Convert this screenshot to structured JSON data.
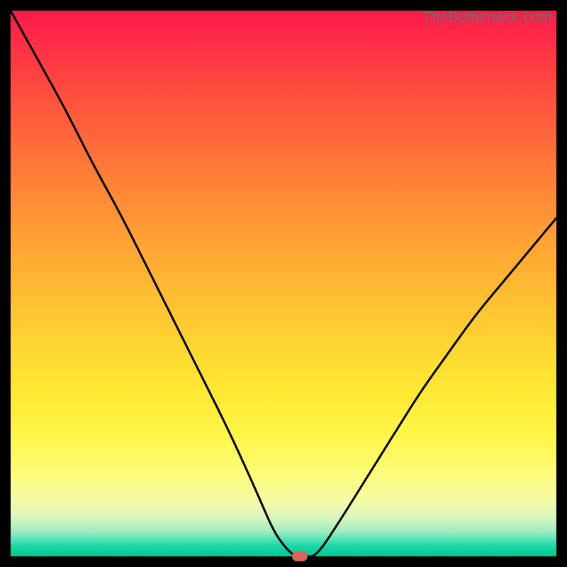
{
  "attribution": "TheBottleneck.com",
  "colors": {
    "curve": "#000000",
    "marker": "#d9645c",
    "frame": "#000000"
  },
  "chart_data": {
    "type": "line",
    "title": "",
    "xlabel": "",
    "ylabel": "",
    "xlim": [
      0,
      100
    ],
    "ylim": [
      0,
      100
    ],
    "grid": false,
    "legend": false,
    "background_gradient": {
      "top": "#ff1a4a",
      "middle": "#ffd732",
      "bottom": "#05c892",
      "note": "red→yellow→green vertical gradient; green (good) near y=0"
    },
    "series": [
      {
        "name": "bottleneck-curve",
        "x": [
          0,
          5,
          10,
          15,
          20,
          25,
          30,
          35,
          40,
          45,
          48,
          50,
          52,
          54,
          56,
          60,
          65,
          70,
          75,
          80,
          85,
          90,
          95,
          100
        ],
        "y": [
          100,
          91,
          82,
          72,
          63,
          53,
          43,
          33,
          23,
          12,
          5,
          2,
          0,
          0,
          0,
          6,
          14,
          22,
          30,
          37,
          44,
          50,
          56,
          62
        ],
        "stroke_width": 3
      }
    ],
    "marker": {
      "x": 53,
      "y": 0,
      "shape": "rounded-rect",
      "color": "#d9645c"
    },
    "notes": "values read off plot; x-axis and y-axis unlabeled in source; curve resembles a V with minimum near x≈53, y≈0"
  }
}
